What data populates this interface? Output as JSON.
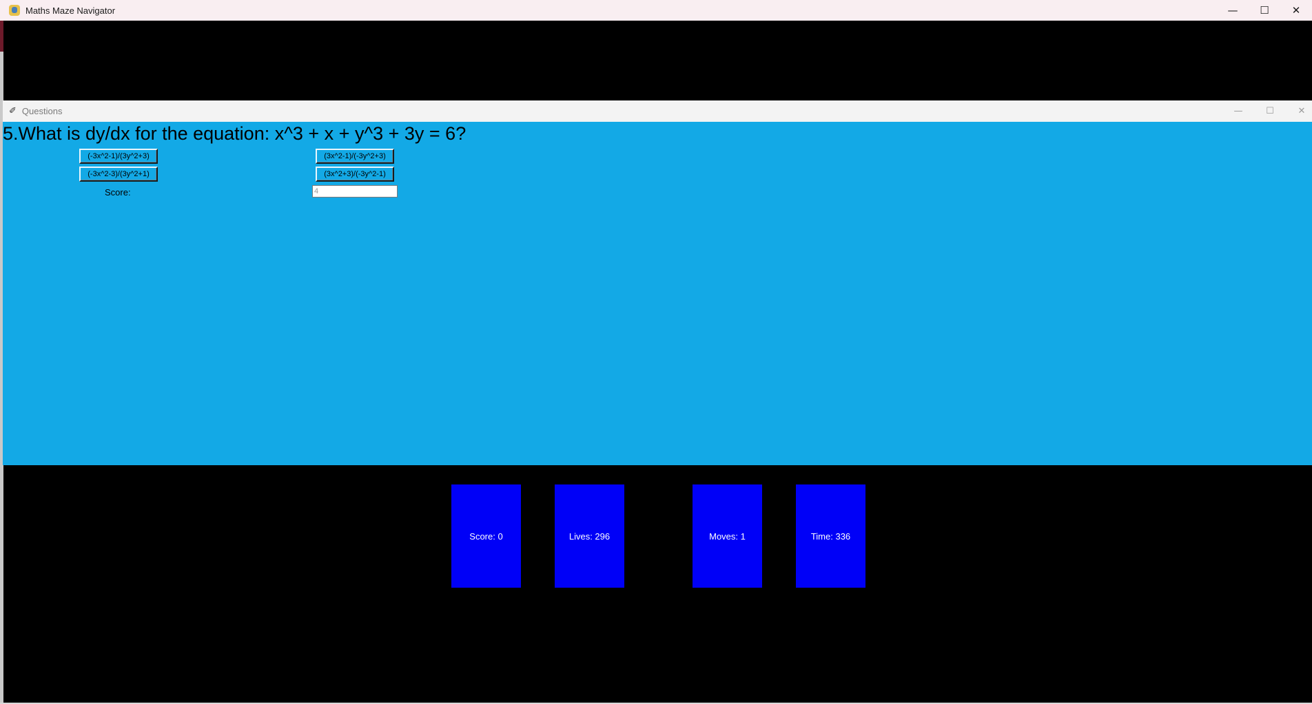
{
  "main_window": {
    "title": "Maths Maze Navigator",
    "controls": {
      "minimize": "—",
      "maximize": "☐",
      "close": "✕"
    }
  },
  "questions_window": {
    "title": "Questions",
    "controls": {
      "minimize": "—",
      "maximize": "☐",
      "close": "✕"
    },
    "question": "5.What is dy/dx for the equation: x^3 + x + y^3 + 3y = 6?",
    "answers": [
      "(-3x^2-1)/(3y^2+3)",
      "(3x^2-1)/(-3y^2+3)",
      "(-3x^2-3)/(3y^2+1)",
      "(3x^2+3)/(-3y^2-1)"
    ],
    "score_label": "Score:",
    "score_value": "4"
  },
  "stats": {
    "score": "Score: 0",
    "lives": "Lives: 296",
    "moves": "Moves: 1",
    "time": "Time: 336"
  },
  "colors": {
    "question_bg": "#13a9e6",
    "stat_box": "#0000f7",
    "game_bg": "#000000"
  }
}
